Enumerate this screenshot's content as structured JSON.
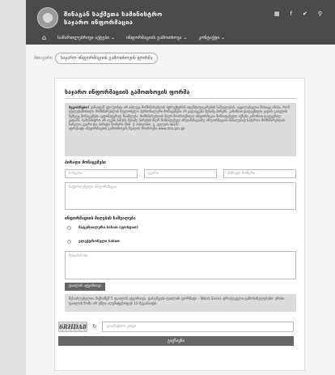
{
  "header": {
    "brand_line1": "შინაგან საქმეთა სამინისტრო",
    "brand_line2": "საჯარო ინფორმაცია",
    "icons": [
      "grid-icon",
      "facebook-icon",
      "twitter-icon",
      "search-icon"
    ],
    "icon_glyphs": [
      "▦",
      "f",
      "✔",
      "⚲"
    ]
  },
  "nav": {
    "home_glyph": "⌂",
    "items": [
      "სამართლებრივი აქტები",
      "ინფორმაციის გამოთხოვა",
      "კონტაქტი"
    ]
  },
  "breadcrumb": {
    "home": "მთავარი",
    "current": "საჯარო ინფორმაციის გამოთხოვის ფორმა"
  },
  "form": {
    "title": "საჯარო ინფორმაციის გამოთხოვის ფორმა",
    "notice_lead": "მეგობრებო!",
    "notice_text": "ვინაიდან ელ-ფოსტა არ იძლევა მომხმარებლის სტრუქტურის იდენტიფიცირების საშუალებას, აუცილებელია მოსაგე იმისა, რომ უფლებამოსილი მომხმარებლის მფლობელი პერსონალური მონაცემები არ გადაეცემა მესამე პირებს. კანონით დადგენილი ვადის გასვლის შემდეგ მონაცემები ავტომატურად წაიშლება. მომხმარებლის მიერ მოთხოვნილი ინფორმაცია მოწოდებული იქნება კანონით დადგენილ ვადაში. სამინისტრო არ აგებს პასუხს მესამე პირების მიერ მოწოდებულ ინფორმაციაზე. ინფორმაციის მისაღებად საჭიროა მომხმარებლის სახელი, გვარი და პირადი ნომერი (მის. ქ. თბილისი, გ. გულუის №10).",
    "notice_footer": "ადრესატი ინფორმაციის გამოთხოვის მეილის მოთხოვნა www.mia.gov.ge",
    "requester_title": "პირადი მონაცემები",
    "first_name_placeholder": "სახელი",
    "last_name_placeholder": "გვარი",
    "personal_id_placeholder": "პირადი ნომერი",
    "requested_info_placeholder": "საჭიროებული ინფორმაცია",
    "delivery_title": "ინფორმაციის მიღების საშუალება",
    "delivery_options": [
      "მატერიალური სახით (ფოსტით)",
      "ელექტრონული სახით"
    ],
    "email_placeholder": "მისამართი",
    "upload_label": "ფაილის ატვირთვა",
    "upload_info": "შესაძლებელია მაქსიმუმ 5 ფაილის ატვირთვა, დასაშვები ფაილის ფორმატი - Word, Excel, ტრაფიკული გამოსახულებები. ერთი ფაილის ზომა არ უნდა აღემატებოდეს 10 მეგაბაიტს.",
    "captcha_text": "6RHDA8",
    "refresh_glyph": "↻",
    "captcha_placeholder": "დაამატოთ კოდი",
    "submit_label": "გაგზავნა"
  }
}
